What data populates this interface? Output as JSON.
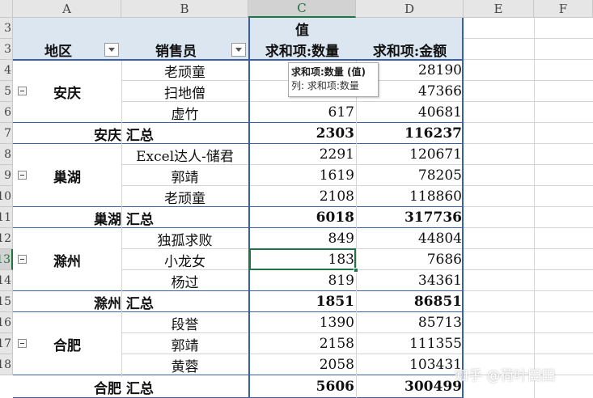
{
  "columns": [
    "A",
    "B",
    "C",
    "D",
    "E",
    "F"
  ],
  "rows": [
    "3",
    "3",
    "3",
    "4",
    "5",
    "6",
    "7",
    "8",
    "9",
    "10",
    "11",
    "12",
    "13",
    "14",
    "15",
    "16",
    "17",
    "18"
  ],
  "pivot": {
    "values_label": "值",
    "region_header": "地区",
    "seller_header": "销售员",
    "qty_header": "求和项:数量",
    "amt_header": "求和项:金额",
    "groups": [
      {
        "region": "安庆",
        "total_label": "安庆 汇总",
        "total_qty": "2303",
        "total_amt": "116237",
        "items": [
          {
            "seller": "老顽童",
            "qty": "",
            "amt": "28190"
          },
          {
            "seller": "扫地僧",
            "qty": "",
            "amt": "47366"
          },
          {
            "seller": "虚竹",
            "qty": "617",
            "amt": "40681"
          }
        ]
      },
      {
        "region": "巢湖",
        "total_label": "巢湖 汇总",
        "total_qty": "6018",
        "total_amt": "317736",
        "items": [
          {
            "seller": "Excel达人-储君",
            "qty": "2291",
            "amt": "120671"
          },
          {
            "seller": "郭靖",
            "qty": "1619",
            "amt": "78205"
          },
          {
            "seller": "老顽童",
            "qty": "2108",
            "amt": "118860"
          }
        ]
      },
      {
        "region": "滁州",
        "total_label": "滁州 汇总",
        "total_qty": "1851",
        "total_amt": "86851",
        "items": [
          {
            "seller": "独孤求败",
            "qty": "849",
            "amt": "44804"
          },
          {
            "seller": "小龙女",
            "qty": "183",
            "amt": "7686"
          },
          {
            "seller": "杨过",
            "qty": "819",
            "amt": "34361"
          }
        ]
      },
      {
        "region": "合肥",
        "total_label": "合肥 汇总",
        "total_qty": "5606",
        "total_amt": "300499",
        "items": [
          {
            "seller": "段誉",
            "qty": "1390",
            "amt": "85713"
          },
          {
            "seller": "郭靖",
            "qty": "2158",
            "amt": "111355"
          },
          {
            "seller": "黄蓉",
            "qty": "2058",
            "amt": "103431"
          }
        ]
      }
    ]
  },
  "tooltip": {
    "title": "求和项:数量 (值)",
    "subtitle": "列: 求和项:数量"
  },
  "watermark": "知乎 @荷叶田田",
  "colors": {
    "pivot_header": "#dce6f1",
    "pivot_border": "#3a5fa8",
    "selection": "#217346"
  }
}
